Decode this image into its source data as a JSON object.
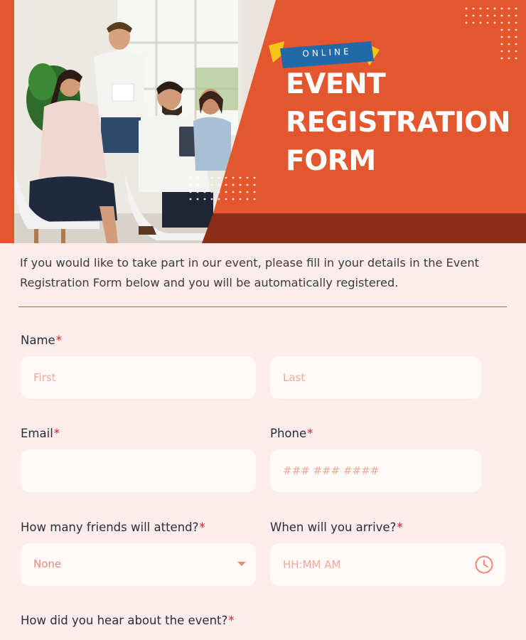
{
  "hero": {
    "badge": "ONLINE",
    "title_lines": [
      "EVENT",
      "REGISTRATION",
      "FORM"
    ]
  },
  "intro": {
    "text": "If you would like to take part in our event, please fill in your details in the Event Registration Form below and you will be automatically registered."
  },
  "form": {
    "required_mark": "*",
    "name": {
      "label": "Name",
      "first_placeholder": "First",
      "last_placeholder": "Last"
    },
    "email": {
      "label": "Email",
      "value": ""
    },
    "phone": {
      "label": "Phone",
      "placeholder": "### ### ####"
    },
    "friends": {
      "label": "How many friends will attend?",
      "selected": "None"
    },
    "arrival": {
      "label": "When will you arrive?",
      "placeholder": "HH:MM AM"
    },
    "source": {
      "label": "How did you hear about the event?"
    }
  },
  "colors": {
    "brand_orange": "#e4572e",
    "dark_band": "#8b2e17",
    "page_bg": "#fcecec",
    "input_bg": "#fffaf7",
    "placeholder": "#f1a99c",
    "required": "#e02020",
    "badge_blue": "#2169a8",
    "badge_yellow": "#f5c518"
  },
  "icons": [
    "clock-icon",
    "chevron-down-icon"
  ]
}
